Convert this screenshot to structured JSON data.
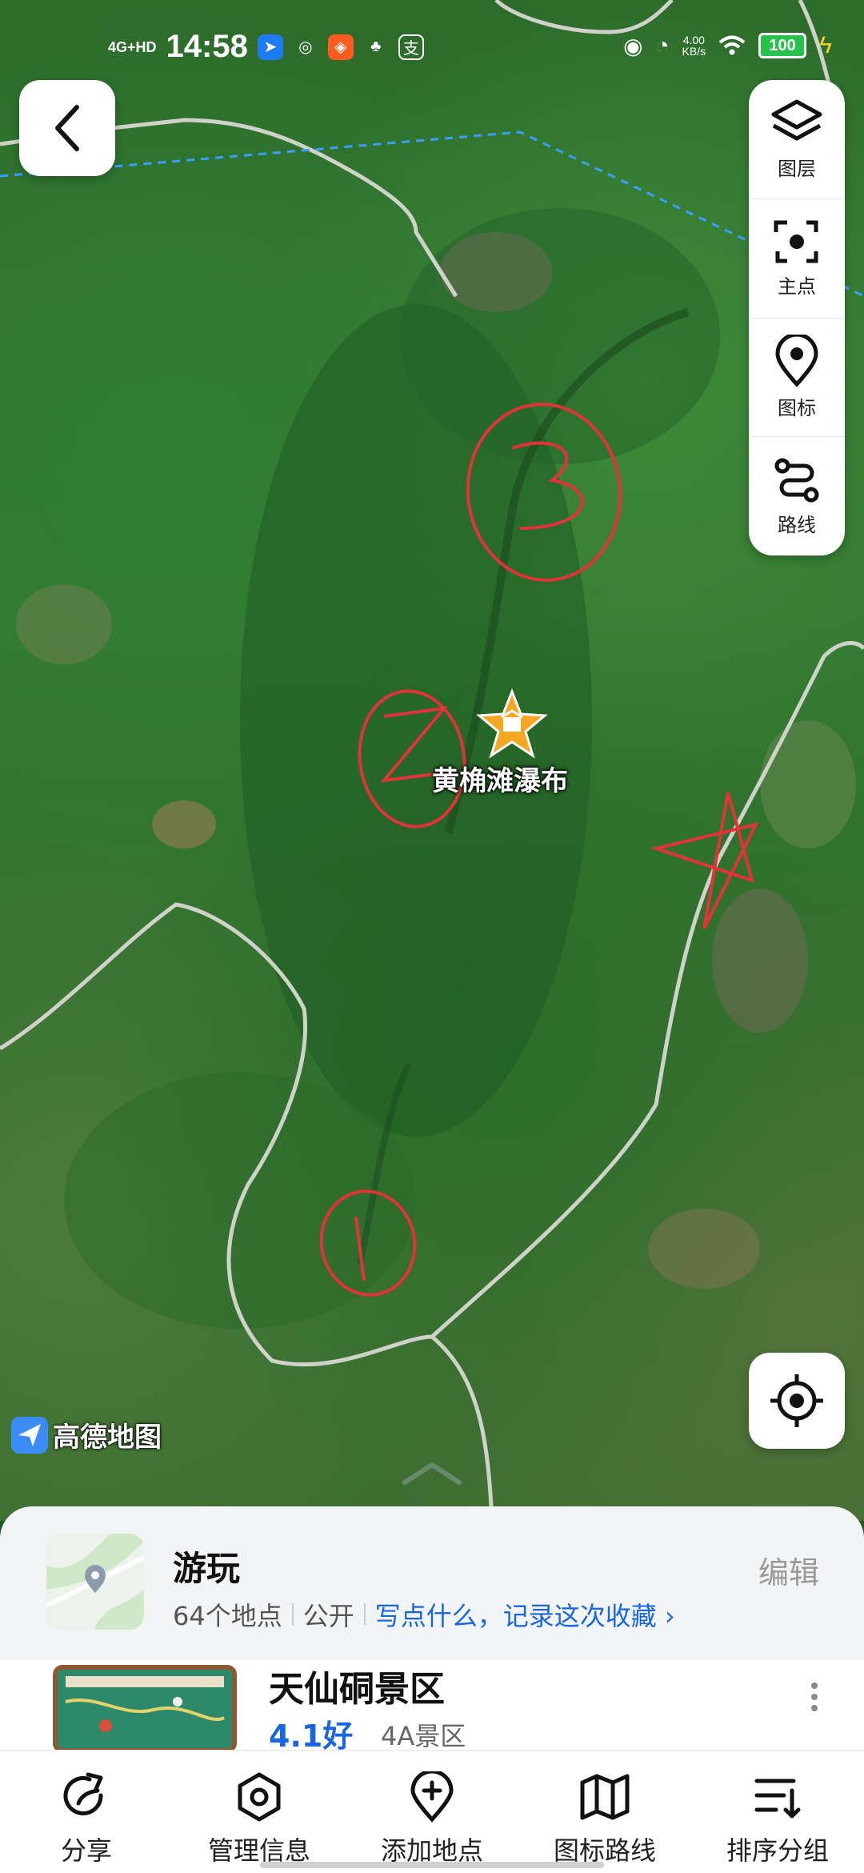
{
  "status_bar": {
    "network": "4G+HD",
    "time": "14:58",
    "speed_value": "4.00",
    "speed_unit": "KB/s",
    "battery": "100"
  },
  "map": {
    "poi_name": "黄桷滩瀑布",
    "poi_color": "#f5a623",
    "provider_logo": "高德地图",
    "annotations": [
      "1",
      "2",
      "3",
      "star"
    ]
  },
  "tools": [
    {
      "icon": "layers-icon",
      "label": "图层"
    },
    {
      "icon": "focus-icon",
      "label": "主点"
    },
    {
      "icon": "pin-icon",
      "label": "图标"
    },
    {
      "icon": "route-icon",
      "label": "路线"
    }
  ],
  "collection": {
    "title": "游玩",
    "count": "64个地点",
    "visibility": "公开",
    "prompt": "写点什么，记录这次收藏",
    "edit_label": "编辑"
  },
  "item": {
    "name": "天仙硐景区",
    "rating": "4.1好",
    "tag": "4A景区"
  },
  "bottom_nav": [
    {
      "icon": "share-icon",
      "label": "分享"
    },
    {
      "icon": "manage-icon",
      "label": "管理信息"
    },
    {
      "icon": "add-location-icon",
      "label": "添加地点"
    },
    {
      "icon": "map-route-icon",
      "label": "图标路线"
    },
    {
      "icon": "sort-icon",
      "label": "排序分组"
    }
  ],
  "colors": {
    "accent_blue": "#1a66e0",
    "annotation_red": "#e0343a",
    "battery_green": "#27c24c"
  }
}
